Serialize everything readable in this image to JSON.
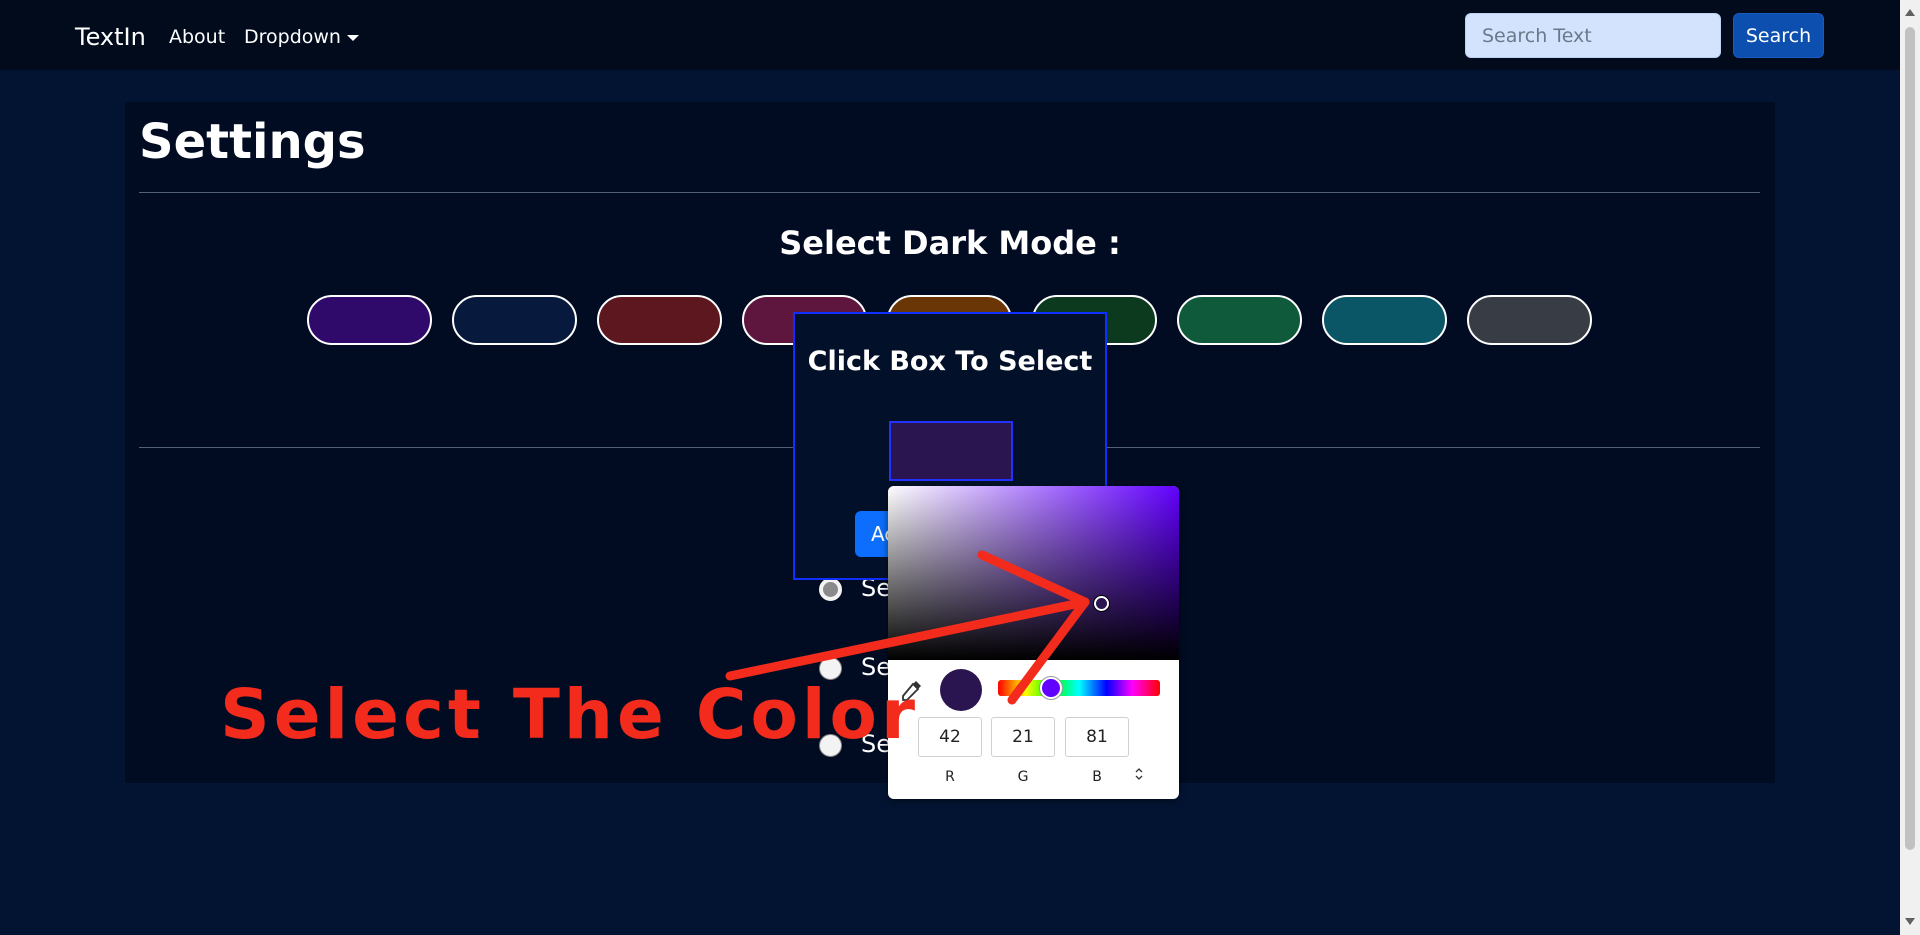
{
  "navbar": {
    "brand": "TextIn",
    "about": "About",
    "dropdown": "Dropdown",
    "search_placeholder": "Search Text",
    "search_button": "Search"
  },
  "settings": {
    "title": "Settings",
    "subtitle": "Select Dark Mode :",
    "swatches": [
      {
        "name": "purple",
        "color": "#2f0a6a"
      },
      {
        "name": "navy",
        "color": "#071a3d"
      },
      {
        "name": "maroon",
        "color": "#5c181e"
      },
      {
        "name": "plum",
        "color": "#5e163e"
      },
      {
        "name": "brown",
        "color": "#6b3606"
      },
      {
        "name": "dark-green",
        "color": "#0b3a1f"
      },
      {
        "name": "green",
        "color": "#0e5a3b"
      },
      {
        "name": "teal",
        "color": "#0a5566"
      },
      {
        "name": "gray",
        "color": "#383c45"
      }
    ],
    "radio_options": [
      {
        "label": "Se",
        "selected": true
      },
      {
        "label": "Se",
        "selected": false
      },
      {
        "label": "Se",
        "selected": false
      }
    ]
  },
  "modal": {
    "title": "Click Box To Select",
    "selected_color": "#2a1551",
    "apply_button": "Ac"
  },
  "color_picker": {
    "hue_color": "#6200ff",
    "current_color": "#2a1551",
    "r": "42",
    "g": "21",
    "b": "81",
    "r_label": "R",
    "g_label": "G",
    "b_label": "B",
    "mode_toggle_icon": "up-down-chevron-icon"
  },
  "annotation": {
    "text": "Select The Color",
    "color": "#f22b1c"
  }
}
